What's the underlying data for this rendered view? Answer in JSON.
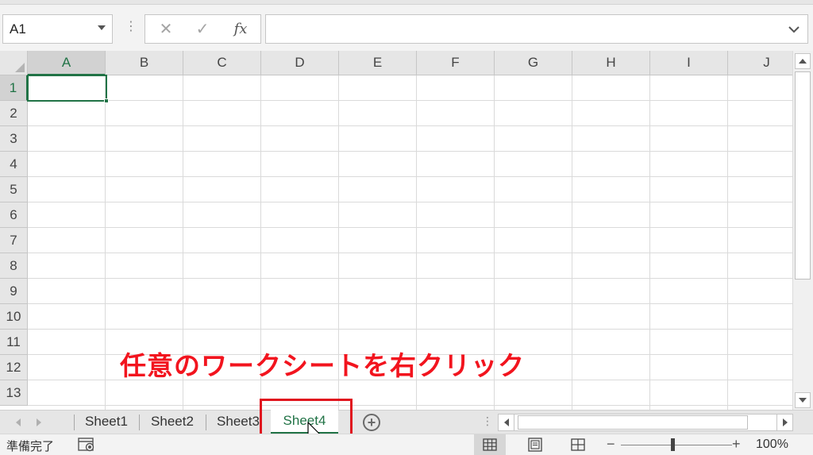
{
  "formula_bar": {
    "name_box_value": "A1",
    "cancel_icon": "close-icon",
    "enter_icon": "checkmark-icon",
    "fx_label": "fx",
    "formula_value": ""
  },
  "grid": {
    "columns": [
      "A",
      "B",
      "C",
      "D",
      "E",
      "F",
      "G",
      "H",
      "I",
      "J"
    ],
    "rows": [
      "1",
      "2",
      "3",
      "4",
      "5",
      "6",
      "7",
      "8",
      "9",
      "10",
      "11",
      "12",
      "13"
    ],
    "selected_cell": "A1"
  },
  "annotation": {
    "text": "任意のワークシートを右クリック",
    "color": "#f2141e"
  },
  "sheet_tabs": {
    "tabs": [
      "Sheet1",
      "Sheet2",
      "Sheet3",
      "Sheet4"
    ],
    "active": "Sheet4"
  },
  "status_bar": {
    "status": "準備完了",
    "zoom": "100%"
  },
  "colors": {
    "accent": "#217346",
    "highlight_box": "#e0141e"
  }
}
